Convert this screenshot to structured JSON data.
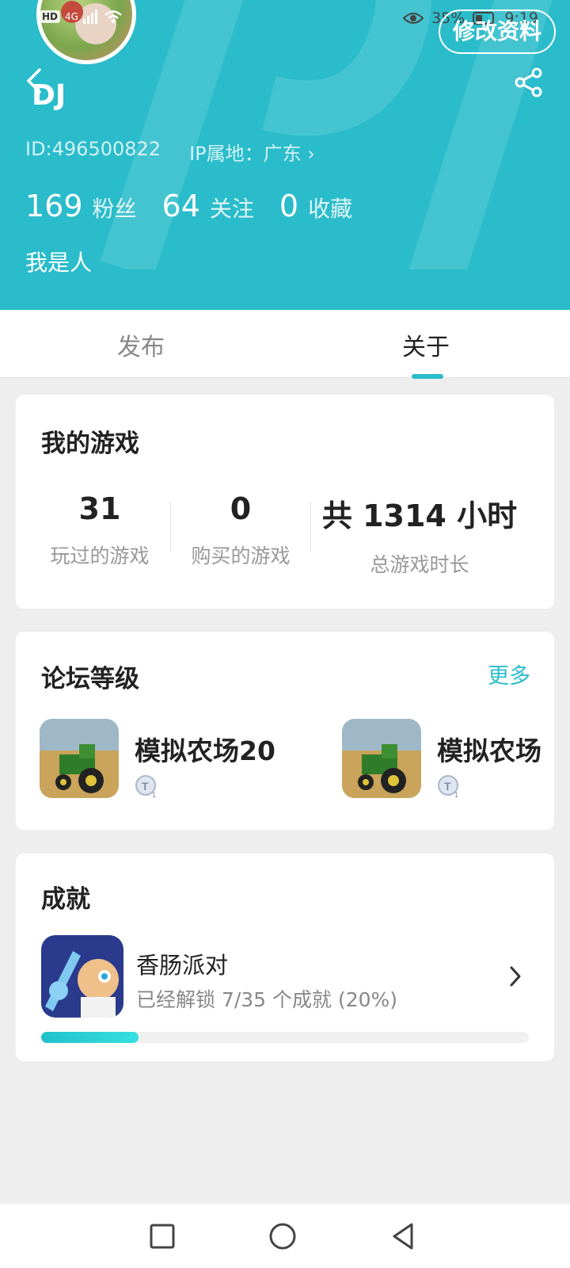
{
  "status_bar": {
    "network": "4G",
    "hd": "HD",
    "battery": "35%",
    "time": "9:19"
  },
  "header": {
    "edit_button": "修改资料",
    "username": "DJ",
    "user_id": "ID:496500822",
    "ip_location": "IP属地：广东",
    "stats": [
      {
        "value": "169",
        "label": "粉丝"
      },
      {
        "value": "64",
        "label": "关注"
      },
      {
        "value": "0",
        "label": "收藏"
      }
    ],
    "bio": "我是人",
    "accent_color": "#2abccb"
  },
  "tabs": {
    "items": [
      {
        "label": "发布",
        "active": false
      },
      {
        "label": "关于",
        "active": true
      }
    ]
  },
  "my_games": {
    "title": "我的游戏",
    "stats": [
      {
        "value": "31",
        "label": "玩过的游戏"
      },
      {
        "value": "0",
        "label": "购买的游戏"
      },
      {
        "value": "共 1314 小时",
        "label": "总游戏时长"
      }
    ]
  },
  "forum_level": {
    "title": "论坛等级",
    "more": "更多",
    "items": [
      {
        "name": "模拟农场20",
        "icon": "tractor-game-icon",
        "level_icon": "level-badge-icon"
      },
      {
        "name": "模拟农场",
        "icon": "tractor-game-icon",
        "level_icon": "level-badge-icon"
      }
    ]
  },
  "achievements": {
    "title": "成就",
    "items": [
      {
        "name": "香肠派对",
        "progress_text": "已经解锁 7/35 个成就 (20%)",
        "progress_fraction": 0.2,
        "icon": "sausage-party-icon"
      }
    ]
  },
  "navbar": {
    "buttons": [
      "recent-apps-icon",
      "home-icon",
      "back-nav-icon"
    ]
  }
}
